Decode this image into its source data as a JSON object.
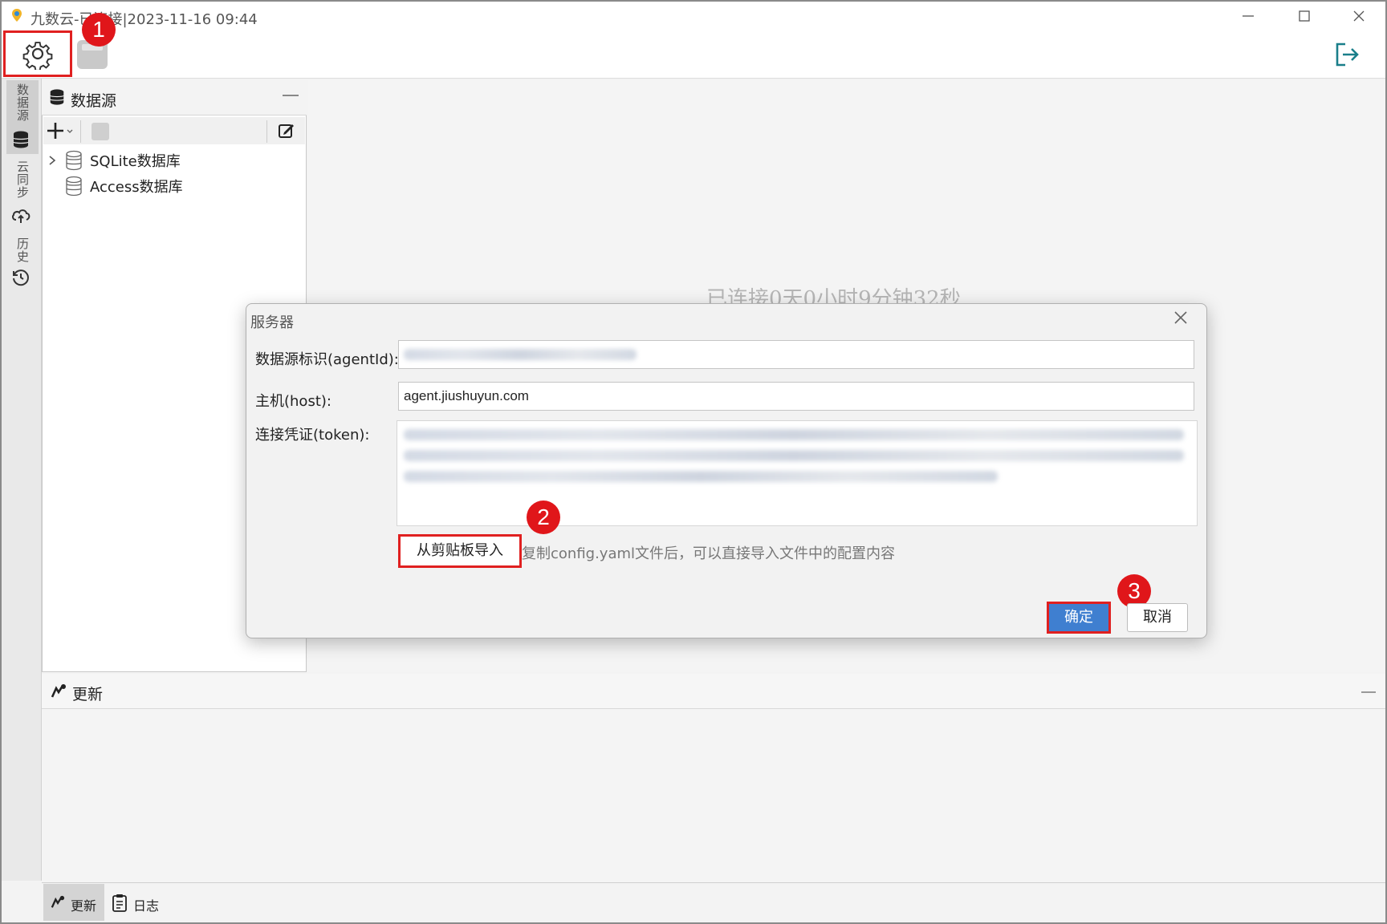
{
  "window": {
    "title": "九数云-已连接|2023-11-16 09:44"
  },
  "toolbar": {
    "settings_icon": "gear-icon",
    "save_icon": "save-icon",
    "logout_icon": "logout-icon"
  },
  "markers": [
    "1",
    "2",
    "3"
  ],
  "side_tabs": [
    {
      "label": "数据源",
      "icon": "database-icon"
    },
    {
      "label": "云同步",
      "icon": "cloud-sync-icon"
    },
    {
      "label": "历史",
      "icon": "history-icon"
    }
  ],
  "datasource_panel": {
    "title": "数据源",
    "items": [
      {
        "label": "SQLite数据库",
        "expandable": true
      },
      {
        "label": "Access数据库",
        "expandable": false
      }
    ]
  },
  "main": {
    "connection_status": "已连接0天0小时9分钟32秒"
  },
  "update_panel": {
    "title": "更新"
  },
  "bottom_tabs": [
    {
      "label": "更新"
    },
    {
      "label": "日志"
    }
  ],
  "dialog": {
    "title": "服务器",
    "agent_label": "数据源标识(agentId):",
    "host_label": "主机(host):",
    "host_value": "agent.jiushuyun.com",
    "token_label": "连接凭证(token):",
    "import_button": "从剪贴板导入",
    "import_hint": "复制config.yaml文件后，可以直接导入文件中的配置内容",
    "ok_button": "确定",
    "cancel_button": "取消"
  },
  "colors": {
    "accent": "#3f7fd0",
    "highlight_box": "#e02020",
    "marker": "#e0161a"
  }
}
